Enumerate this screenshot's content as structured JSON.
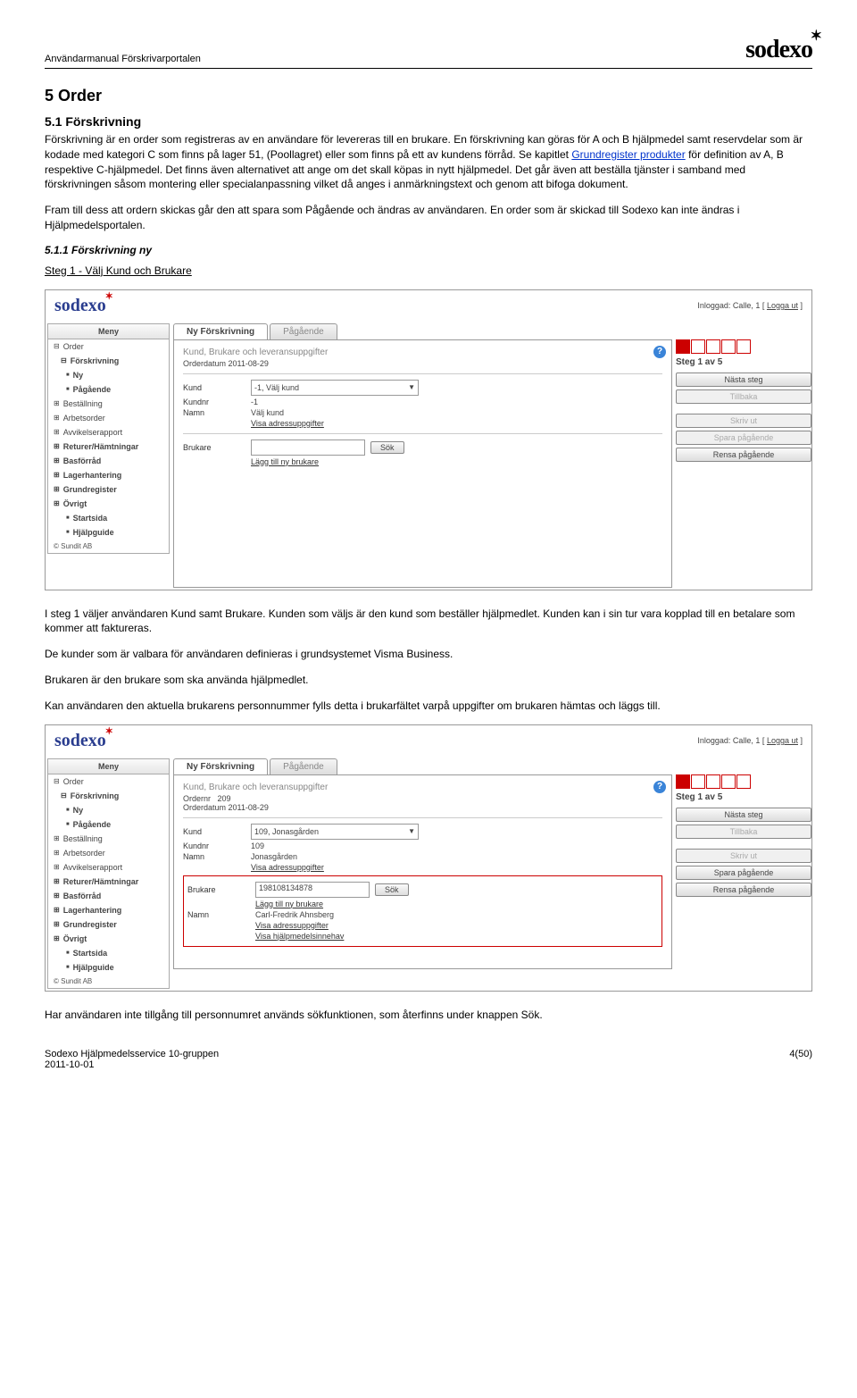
{
  "doc": {
    "header_left": "Användarmanual Förskrivarportalen",
    "logo": "sodexo",
    "h1": "5  Order",
    "h2": "5.1  Förskrivning",
    "p1a": "Förskrivning är en order som registreras av en användare för levereras till en brukare. En förskrivning kan göras för A och B hjälpmedel samt reservdelar som är kodade med kategori C som finns på lager 51, (Poollagret) eller som finns på ett av kundens förråd. Se kapitlet ",
    "p1_link": "Grundregister produkter",
    "p1b": " för definition av A, B respektive C-hjälpmedel. Det finns även alternativet att ange om det skall köpas in nytt hjälpmedel. Det går även att beställa tjänster i samband med förskrivningen såsom montering eller specialanpassning vilket då anges i anmärkningstext och genom att bifoga dokument.",
    "p2": "Fram till dess att ordern skickas går den att spara som Pågående och ändras av användaren. En order som är skickad till Sodexo kan inte ändras i Hjälpmedelsportalen.",
    "h3": "5.1.1 Förskrivning ny",
    "step1_title": "Steg 1 - Välj Kund och Brukare",
    "after_s1_p1": "I steg 1 väljer användaren Kund samt Brukare. Kunden som väljs är den kund som beställer hjälpmedlet. Kunden kan i sin tur vara kopplad till en betalare som kommer att faktureras.",
    "after_s1_p2": "De kunder som är valbara för användaren definieras i grundsystemet Visma Business.",
    "after_s1_p3": "Brukaren är den brukare som ska använda hjälpmedlet.",
    "after_s1_p4": "Kan användaren den aktuella brukarens personnummer fylls detta i brukarfältet varpå uppgifter om brukaren hämtas och läggs till.",
    "after_s2_p1": "Har användaren inte tillgång till personnumret används sökfunktionen, som återfinns under knappen Sök.",
    "footer_left1": "Sodexo Hjälpmedelsservice 10-gruppen",
    "footer_left2": "2011-10-01",
    "footer_right": "4(50)"
  },
  "ss_common": {
    "logo": "sodexo",
    "logged_in_prefix": "Inloggad: Calle, 1 [ ",
    "logout": "Logga ut",
    "logged_in_suffix": " ]",
    "menu_title": "Meny",
    "menu": [
      {
        "label": "Order",
        "cls": "l1"
      },
      {
        "label": "Förskrivning",
        "cls": "l1 bold",
        "indent": true
      },
      {
        "label": "Ny",
        "cls": "l2 bold"
      },
      {
        "label": "Pågående",
        "cls": "l2 bold"
      },
      {
        "label": "Beställning",
        "cls": "l1p"
      },
      {
        "label": "Arbetsorder",
        "cls": "l1p"
      },
      {
        "label": "Avvikelserapport",
        "cls": "l1p"
      },
      {
        "label": "Returer/Hämtningar",
        "cls": "l1p bold"
      },
      {
        "label": "Basförråd",
        "cls": "l1p bold"
      },
      {
        "label": "Lagerhantering",
        "cls": "l1p bold"
      },
      {
        "label": "Grundregister",
        "cls": "l1p bold"
      },
      {
        "label": "Övrigt",
        "cls": "l1p bold"
      },
      {
        "label": "Startsida",
        "cls": "l2 bold"
      },
      {
        "label": "Hjälpguide",
        "cls": "l2 bold"
      }
    ],
    "copyright": "© Sundit AB",
    "tab_ny": "Ny Förskrivning",
    "tab_pag": "Pågående",
    "panel_title": "Kund, Brukare och leveransuppgifter",
    "lbl_kund": "Kund",
    "lbl_kundnr": "Kundnr",
    "lbl_namn": "Namn",
    "adress_link": "Visa adressuppgifter",
    "lbl_brukare": "Brukare",
    "sok": "Sök",
    "add_brukare": "Lägg till ny brukare",
    "step_label": "Steg 1 av 5",
    "btn_next": "Nästa steg",
    "btn_back": "Tillbaka",
    "btn_print": "Skriv ut",
    "btn_save": "Spara pågående",
    "btn_clear": "Rensa pågående"
  },
  "ss1": {
    "orderdatum": "Orderdatum 2011-08-29",
    "kund_select": "-1, Välj kund",
    "kundnr": "-1",
    "namn": "Välj kund"
  },
  "ss2": {
    "ordernr_label": "Ordernr",
    "ordernr": "209",
    "orderdatum": "Orderdatum 2011-08-29",
    "kund_select": "109, Jonasgården",
    "kundnr": "109",
    "namn": "Jonasgården",
    "brukare_input": "198108134878",
    "brukare_namn": "Carl-Fredrik Ahnsberg",
    "adress_link2": "Visa adressuppgifter",
    "hjalpmedel_link": "Visa hjälpmedelsinnehav"
  }
}
